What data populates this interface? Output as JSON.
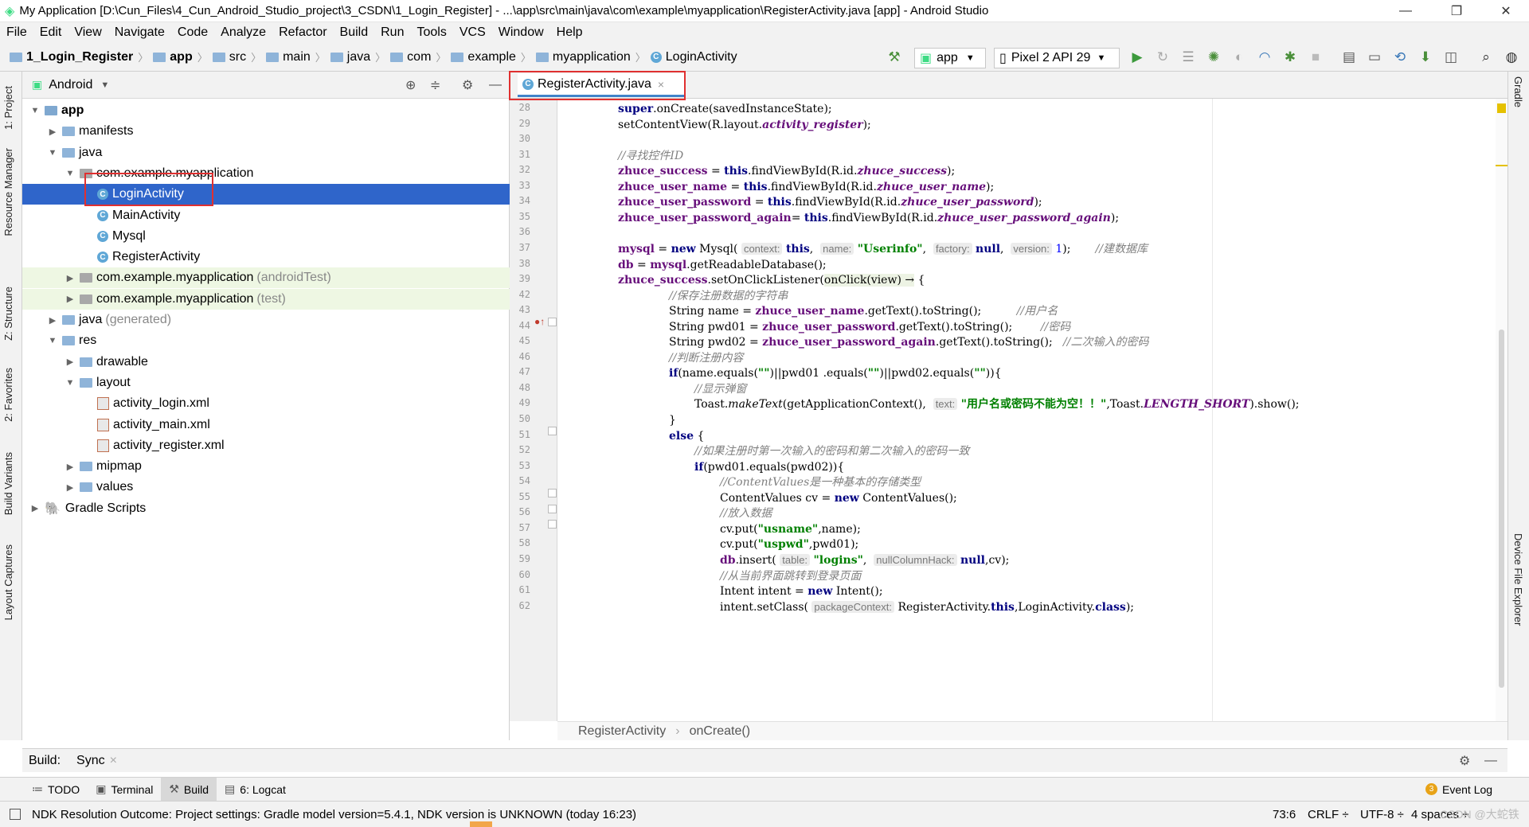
{
  "window": {
    "title": "My Application [D:\\Cun_Files\\4_Cun_Android_Studio_project\\3_CSDN\\1_Login_Register] - ...\\app\\src\\main\\java\\com\\example\\myapplication\\RegisterActivity.java [app] - Android Studio",
    "minimize": "—",
    "maximize": "❐",
    "close": "✕"
  },
  "menu": [
    "File",
    "Edit",
    "View",
    "Navigate",
    "Code",
    "Analyze",
    "Refactor",
    "Build",
    "Run",
    "Tools",
    "VCS",
    "Window",
    "Help"
  ],
  "breadcrumb": [
    "1_Login_Register",
    "app",
    "src",
    "main",
    "java",
    "com",
    "example",
    "myapplication",
    "LoginActivity"
  ],
  "toolbar": {
    "run_config": "app",
    "device": "Pixel 2 API 29"
  },
  "left_tool_tabs": [
    "1: Project",
    "Resource Manager",
    "Z: Structure",
    "2: Favorites",
    "Build Variants",
    "Layout Captures"
  ],
  "right_tool_tabs": [
    "Gradle",
    "Device File Explorer"
  ],
  "project": {
    "view_mode": "Android",
    "tree": [
      {
        "label": "app",
        "extra": "",
        "depth": 0,
        "arrow": "▼",
        "icon": "module"
      },
      {
        "label": "manifests",
        "extra": "",
        "depth": 1,
        "arrow": "▶",
        "icon": "folder"
      },
      {
        "label": "java",
        "extra": "",
        "depth": 1,
        "arrow": "▼",
        "icon": "folder"
      },
      {
        "label": "com.example.myapplication",
        "extra": "",
        "depth": 2,
        "arrow": "▼",
        "icon": "package"
      },
      {
        "label": "LoginActivity",
        "extra": "",
        "depth": 3,
        "arrow": "",
        "icon": "class",
        "selected": true
      },
      {
        "label": "MainActivity",
        "extra": "",
        "depth": 3,
        "arrow": "",
        "icon": "class"
      },
      {
        "label": "Mysql",
        "extra": "",
        "depth": 3,
        "arrow": "",
        "icon": "class"
      },
      {
        "label": "RegisterActivity",
        "extra": "",
        "depth": 3,
        "arrow": "",
        "icon": "class"
      },
      {
        "label": "com.example.myapplication",
        "extra": "(androidTest)",
        "depth": 2,
        "arrow": "▶",
        "icon": "package",
        "test": true
      },
      {
        "label": "com.example.myapplication",
        "extra": "(test)",
        "depth": 2,
        "arrow": "▶",
        "icon": "package",
        "test": true
      },
      {
        "label": "java",
        "extra": "(generated)",
        "depth": 1,
        "arrow": "▶",
        "icon": "folder"
      },
      {
        "label": "res",
        "extra": "",
        "depth": 1,
        "arrow": "▼",
        "icon": "folder"
      },
      {
        "label": "drawable",
        "extra": "",
        "depth": 2,
        "arrow": "▶",
        "icon": "folder"
      },
      {
        "label": "layout",
        "extra": "",
        "depth": 2,
        "arrow": "▼",
        "icon": "folder"
      },
      {
        "label": "activity_login.xml",
        "extra": "",
        "depth": 3,
        "arrow": "",
        "icon": "xml"
      },
      {
        "label": "activity_main.xml",
        "extra": "",
        "depth": 3,
        "arrow": "",
        "icon": "xml"
      },
      {
        "label": "activity_register.xml",
        "extra": "",
        "depth": 3,
        "arrow": "",
        "icon": "xml"
      },
      {
        "label": "mipmap",
        "extra": "",
        "depth": 2,
        "arrow": "▶",
        "icon": "folder"
      },
      {
        "label": "values",
        "extra": "",
        "depth": 2,
        "arrow": "▶",
        "icon": "folder"
      },
      {
        "label": "Gradle Scripts",
        "extra": "",
        "depth": 0,
        "arrow": "▶",
        "icon": "gradle"
      }
    ]
  },
  "editor": {
    "tab": "RegisterActivity.java",
    "tab_close": "×",
    "lines": [
      {
        "n": "28",
        "indent": 4,
        "html": "<span class='kw'>super</span>.onCreate(savedInstanceState);"
      },
      {
        "n": "29",
        "indent": 4,
        "html": "setContentView(R.layout.<span class='ital'>activity_register</span>);"
      },
      {
        "n": "30",
        "indent": 0,
        "html": ""
      },
      {
        "n": "31",
        "indent": 4,
        "html": "<span class='cmt'>//寻找控件ID</span>"
      },
      {
        "n": "32",
        "indent": 4,
        "html": "<span class='fld'>zhuce_success</span> = <span class='kw'>this</span>.findViewById(R.id.<span class='ital'>zhuce_success</span>);"
      },
      {
        "n": "33",
        "indent": 4,
        "html": "<span class='fld'>zhuce_user_name</span> = <span class='kw'>this</span>.findViewById(R.id.<span class='ital'>zhuce_user_name</span>);"
      },
      {
        "n": "34",
        "indent": 4,
        "html": "<span class='fld'>zhuce_user_password</span> = <span class='kw'>this</span>.findViewById(R.id.<span class='ital'>zhuce_user_password</span>);"
      },
      {
        "n": "35",
        "indent": 4,
        "html": "<span class='fld'>zhuce_user_password_again</span>= <span class='kw'>this</span>.findViewById(R.id.<span class='ital'>zhuce_user_password_again</span>);"
      },
      {
        "n": "36",
        "indent": 0,
        "html": ""
      },
      {
        "n": "37",
        "indent": 4,
        "html": "<span class='fld'>mysql</span> = <span class='kw'>new</span> Mysql( <span class='hint'>context:</span> <span class='kw'>this</span>,  <span class='hint'>name:</span> <span class='str'>\"Userinfo\"</span>,  <span class='hint'>factory:</span> <span class='kw'>null</span>,  <span class='hint'>version:</span> <span style='color:#0000ff'>1</span>);       <span class='cmt'>//建数据库</span>"
      },
      {
        "n": "38",
        "indent": 4,
        "html": "<span class='fld'>db</span> = <span class='fld'>mysql</span>.getReadableDatabase();"
      },
      {
        "n": "39",
        "indent": 4,
        "html": "<span class='fld'>zhuce_success</span>.setOnClickListener(<span style='background:#edf3e4'>onClick(view) →</span> {"
      },
      {
        "n": "42",
        "indent": 8,
        "html": "<span class='cmt'>//保存注册数据的字符串</span>"
      },
      {
        "n": "43",
        "indent": 8,
        "html": "String name = <span class='fld'>zhuce_user_name</span>.getText().toString();          <span class='cmt'>//用户名</span>"
      },
      {
        "n": "44",
        "indent": 8,
        "html": "String pwd01 = <span class='fld'>zhuce_user_password</span>.getText().toString();        <span class='cmt'>//密码</span>"
      },
      {
        "n": "45",
        "indent": 8,
        "html": "String pwd02 = <span class='fld'>zhuce_user_password_again</span>.getText().toString();   <span class='cmt'>//二次输入的密码</span>"
      },
      {
        "n": "46",
        "indent": 8,
        "html": "<span class='cmt'>//判断注册内容</span>"
      },
      {
        "n": "47",
        "indent": 8,
        "html": "<span class='kw'>if</span>(name.equals(<span class='str'>\"\"</span>)||pwd01 .equals(<span class='str'>\"\"</span>)||pwd02.equals(<span class='str'>\"\"</span>)){"
      },
      {
        "n": "48",
        "indent": 10,
        "html": "<span class='cmt'>//显示弹窗</span>"
      },
      {
        "n": "49",
        "indent": 10,
        "html": "Toast.<i>makeText</i>(getApplicationContext(),  <span class='hint'>text:</span> <span class='str'>\"用户名或密码不能为空！！\"</span>,Toast.<span class='ital'>LENGTH_SHORT</span>).show();"
      },
      {
        "n": "50",
        "indent": 8,
        "html": "}"
      },
      {
        "n": "51",
        "indent": 8,
        "html": "<span class='kw'>else</span> {"
      },
      {
        "n": "52",
        "indent": 10,
        "html": "<span class='cmt'>//如果注册时第一次输入的密码和第二次输入的密码一致</span>"
      },
      {
        "n": "53",
        "indent": 10,
        "html": "<span class='kw'>if</span>(pwd01.equals(pwd02)){"
      },
      {
        "n": "54",
        "indent": 12,
        "html": "<span class='cmt'>//ContentValues是一种基本的存储类型</span>"
      },
      {
        "n": "55",
        "indent": 12,
        "html": "ContentValues cv = <span class='kw'>new</span> ContentValues();"
      },
      {
        "n": "56",
        "indent": 12,
        "html": "<span class='cmt'>//放入数据</span>"
      },
      {
        "n": "57",
        "indent": 12,
        "html": "cv.put(<span class='str'>\"usname\"</span>,name);"
      },
      {
        "n": "58",
        "indent": 12,
        "html": "cv.put(<span class='str'>\"uspwd\"</span>,pwd01);"
      },
      {
        "n": "59",
        "indent": 12,
        "html": "<span class='fld'>db</span>.insert( <span class='hint'>table:</span> <span class='str'>\"logins\"</span>,  <span class='hint'>nullColumnHack:</span> <span class='kw'>null</span>,cv);"
      },
      {
        "n": "60",
        "indent": 12,
        "html": "<span class='cmt'>//从当前界面跳转到登录页面</span>"
      },
      {
        "n": "61",
        "indent": 12,
        "html": "Intent intent = <span class='kw'>new</span> Intent();"
      },
      {
        "n": "62",
        "indent": 12,
        "html": "intent.setClass( <span class='hint'>packageContext:</span> RegisterActivity.<span class='kw'>this</span>,LoginActivity.<span class='kw'>class</span>);"
      }
    ],
    "breadcrumb": [
      "RegisterActivity",
      "onCreate()"
    ]
  },
  "build": {
    "label": "Build:",
    "sync_tab": "Sync",
    "sync_close": "×"
  },
  "bottom_tabs": [
    "TODO",
    "Terminal",
    "Build",
    "6: Logcat"
  ],
  "event_log": {
    "count": "3",
    "label": "Event Log"
  },
  "status": {
    "message": "NDK Resolution Outcome: Project settings: Gradle model version=5.4.1, NDK version is UNKNOWN (today 16:23)",
    "position": "73:6",
    "line_sep": "CRLF ÷",
    "encoding": "UTF-8 ÷",
    "indent": "4 spaces ÷",
    "watermark": "CSDN @大蛇铁"
  },
  "colors": {
    "selection": "#2f65ca",
    "highlight_box": "#e03030",
    "accent_run": "#43a047"
  }
}
